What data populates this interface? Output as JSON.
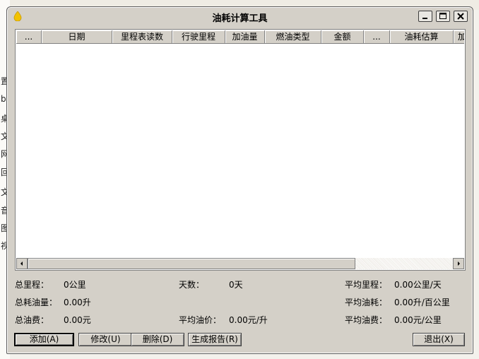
{
  "window": {
    "title": "油耗计算工具"
  },
  "background": {
    "left_glyphs": [
      "置",
      "b",
      "桌",
      "文",
      "网",
      "回",
      "文",
      "音",
      "图",
      "视"
    ]
  },
  "list": {
    "columns": [
      "...",
      "日期",
      "里程表读数",
      "行驶里程",
      "加油量",
      "燃油类型",
      "金额",
      "...",
      "油耗估算",
      "加"
    ]
  },
  "stats": {
    "total_mileage_label": "总里程：",
    "total_mileage_value": "0公里",
    "days_label": "天数：",
    "days_value": "0天",
    "avg_mileage_label": "平均里程：",
    "avg_mileage_value": "0.00公里/天",
    "total_fuel_label": "总耗油量：",
    "total_fuel_value": "0.00升",
    "avg_consumption_label": "平均油耗：",
    "avg_consumption_value": "0.00升/百公里",
    "total_cost_label": "总油费：",
    "total_cost_value": "0.00元",
    "avg_price_label": "平均油价：",
    "avg_price_value": "0.00元/升",
    "avg_cost_label": "平均油费：",
    "avg_cost_value": "0.00元/公里"
  },
  "buttons": {
    "add": "添加(A)",
    "modify": "修改(U)",
    "delete": "删除(D)",
    "report": "生成报告(R)",
    "exit": "退出(X)"
  },
  "colors": {
    "dialog_face": "#d4d0c8",
    "list_background": "#ffffff",
    "app_icon": "#f2c200"
  }
}
